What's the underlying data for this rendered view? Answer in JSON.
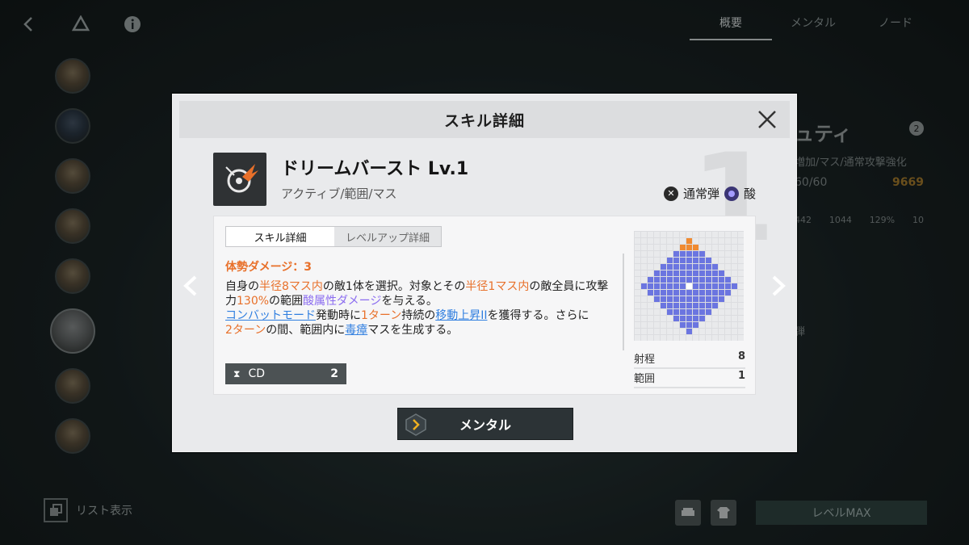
{
  "background": {
    "tabs": [
      "概要",
      "メンタル",
      "ノード"
    ],
    "list_label": "リスト表示",
    "level_button": "レベルMAX",
    "char": {
      "name_partial": "ュティ",
      "badge": "2",
      "subtitle": "増加/マス/通常攻撃強化",
      "hp": "60/60",
      "power": "9669",
      "stats": [
        "442",
        "1044",
        "129%",
        "10"
      ],
      "weapon_label": "弾"
    },
    "icons": [
      "back-icon",
      "drive-icon",
      "info-icon"
    ]
  },
  "modal": {
    "title": "スキル詳細",
    "skill_name": "ドリームバースト Lv.1",
    "skill_type": "アクティブ/範囲/マス",
    "big_number": "1",
    "element_bullet": "通常弾",
    "element_attr": "酸",
    "tabs": {
      "detail": "スキル詳細",
      "levelup": "レベルアップ詳細"
    },
    "posture_label": "体勢ダメージ：3",
    "description": {
      "s1": "自身の",
      "s2": "半径8マス内",
      "s3": "の敵1体を選択。対象とその",
      "s4": "半径1マス内",
      "s5": "の敵全員に攻撃力",
      "s6": "130%",
      "s7": "の範囲",
      "s8": "酸属性ダメージ",
      "s9": "を与える。",
      "s10": "コンバットモード",
      "s11": "発動時に",
      "s12": "1ターン",
      "s13": "持続の",
      "s14": "移動上昇II",
      "s15": "を獲得する。さらに",
      "s16": "2ターン",
      "s17": "の間、範囲内に",
      "s18": "毒瘴",
      "s19": "マスを生成する。"
    },
    "cd": {
      "label": "CD",
      "value": "2"
    },
    "stats": [
      {
        "label": "射程",
        "value": "8"
      },
      {
        "label": "範囲",
        "value": "1"
      }
    ],
    "mental_button": "メンタル",
    "colors": {
      "orange": "#e8702a",
      "purple": "#8b6cf0",
      "blue": "#2f7ee0",
      "grid_blue": "#6b75e0",
      "grid_orange": "#f08a30"
    }
  }
}
